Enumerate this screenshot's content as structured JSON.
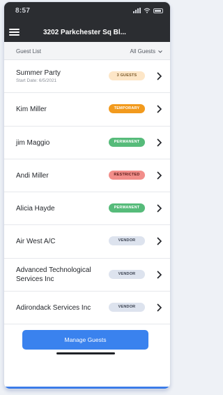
{
  "status_bar": {
    "time": "8:57"
  },
  "header": {
    "title": "3202 Parkchester Sq Bl..."
  },
  "list_header": {
    "title": "Guest List",
    "filter_value": "All Guests"
  },
  "guests": [
    {
      "name": "Summer Party",
      "subtitle": "Start Date: 6/5/2021",
      "badge": "3 GUESTS",
      "badge_type": "guests"
    },
    {
      "name": "Kim Miller",
      "subtitle": "",
      "badge": "TEMPORARY",
      "badge_type": "temporary"
    },
    {
      "name": "jim Maggio",
      "subtitle": "",
      "badge": "PERMANENT",
      "badge_type": "permanent"
    },
    {
      "name": "Andi Miller",
      "subtitle": "",
      "badge": "RESTRICTED",
      "badge_type": "restricted"
    },
    {
      "name": "Alicia Hayde",
      "subtitle": "",
      "badge": "PERMANENT",
      "badge_type": "permanent"
    },
    {
      "name": "Air West A/C",
      "subtitle": "",
      "badge": "VENDOR",
      "badge_type": "vendor"
    },
    {
      "name": "Advanced Technological Services Inc",
      "subtitle": "",
      "badge": "VENDOR",
      "badge_type": "vendor"
    },
    {
      "name": "Adirondack Services Inc",
      "subtitle": "",
      "badge": "VENDOR",
      "badge_type": "vendor"
    }
  ],
  "footer": {
    "manage_label": "Manage Guests"
  },
  "colors": {
    "nav_background": "#2b2d31",
    "accent": "#3a82ee",
    "temporary": "#f29a1d",
    "permanent": "#56bb7a",
    "restricted": "#f28e8a",
    "vendor": "#dde3ee",
    "guests": "#fde6c7"
  }
}
